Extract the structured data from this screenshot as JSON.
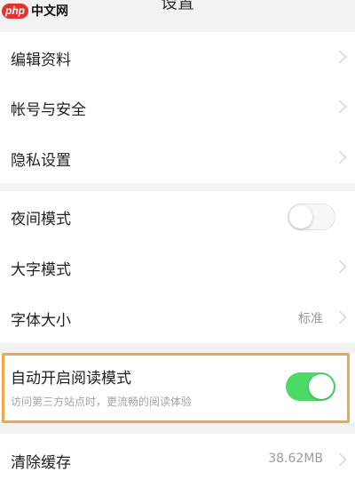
{
  "header": {
    "title": "设置"
  },
  "watermark": {
    "badge": "php",
    "text": "中文网"
  },
  "group1": [
    {
      "label": "编辑资料"
    },
    {
      "label": "帐号与安全"
    },
    {
      "label": "隐私设置"
    }
  ],
  "group2": {
    "night_mode": {
      "label": "夜间模式",
      "toggle": "off"
    },
    "large_font": {
      "label": "大字模式"
    },
    "font_size": {
      "label": "字体大小",
      "value": "标准"
    }
  },
  "reading_mode": {
    "label": "自动开启阅读模式",
    "description": "访问第三方站点时，更流畅的阅读体验",
    "toggle": "on"
  },
  "clear_cache": {
    "label": "清除缓存",
    "value": "38.62MB"
  },
  "colors": {
    "toggle_on": "#4cd964",
    "highlight": "#f0a64a",
    "watermark_red": "#e5322d"
  }
}
